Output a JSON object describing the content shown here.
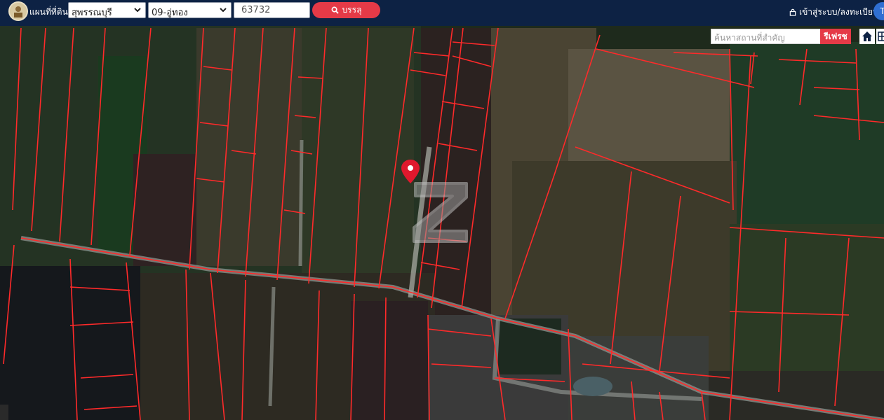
{
  "header": {
    "brand": "แผนที่ที่ดิน",
    "province": "สุพรรณบุรี",
    "district": "09-อู่ทอง",
    "parcel_no": "63732",
    "search_label": "บรรลุ",
    "login_label": "เข้าสู่ระบบ/ลงทะเบียน",
    "avatar_initial": "T"
  },
  "map": {
    "search_placeholder": "ค้นหาสถานที่สำคัญ",
    "search_button": "รีเฟรช",
    "parcel_line_color": "#ff2a2a",
    "marker_color": "#e0182d",
    "icons": [
      "location-pin-icon",
      "watermark-z-icon",
      "home-icon",
      "layers-icon"
    ]
  }
}
